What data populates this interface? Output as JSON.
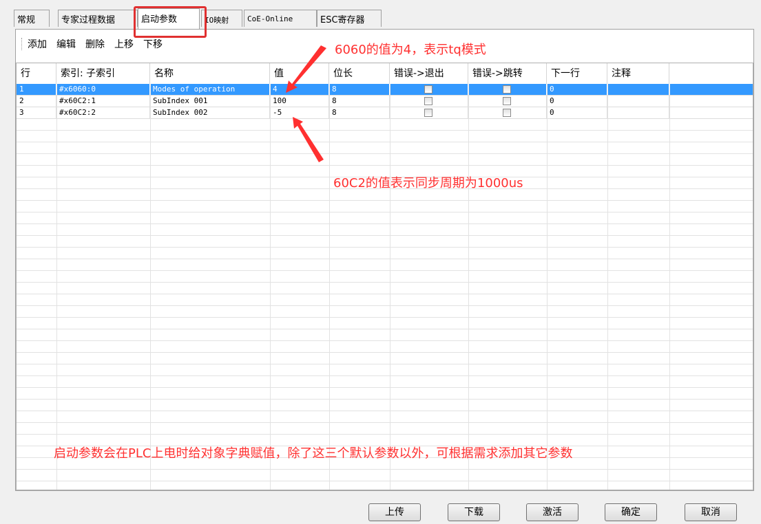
{
  "tabs": [
    {
      "label": "常规"
    },
    {
      "label": "专家过程数据"
    },
    {
      "label": "启动参数"
    },
    {
      "label": "IO映射"
    },
    {
      "label": "CoE-Online"
    },
    {
      "label": "ESC寄存器"
    }
  ],
  "toolbar": {
    "add": "添加",
    "edit": "编辑",
    "delete": "删除",
    "move_up": "上移",
    "move_down": "下移"
  },
  "table": {
    "headers": [
      "行",
      "索引: 子索引",
      "名称",
      "值",
      "位长",
      "错误->退出",
      "错误->跳转",
      "下一行",
      "注释"
    ],
    "rows": [
      {
        "row": "1",
        "index": "#x6060:0",
        "name": "Modes of operation",
        "value": "4",
        "bits": "8",
        "next": "0",
        "selected": true
      },
      {
        "row": "2",
        "index": "#x60C2:1",
        "name": "SubIndex 001",
        "value": "100",
        "bits": "8",
        "next": "0",
        "selected": false
      },
      {
        "row": "3",
        "index": "#x60C2:2",
        "name": "SubIndex 002",
        "value": "-5",
        "bits": "8",
        "next": "0",
        "selected": false
      }
    ]
  },
  "annotations": {
    "a1": "6060的值为4，表示tq模式",
    "a2": "60C2的值表示同步周期为1000us",
    "a3": "启动参数会在PLC上电时给对象字典赋值，除了这三个默认参数以外，可根据需求添加其它参数"
  },
  "buttons": {
    "upload": "上传",
    "download": "下载",
    "activate": "激活",
    "ok": "确定",
    "cancel": "取消"
  },
  "colors": {
    "selection": "#3399ff",
    "annotation": "#ff3030"
  }
}
